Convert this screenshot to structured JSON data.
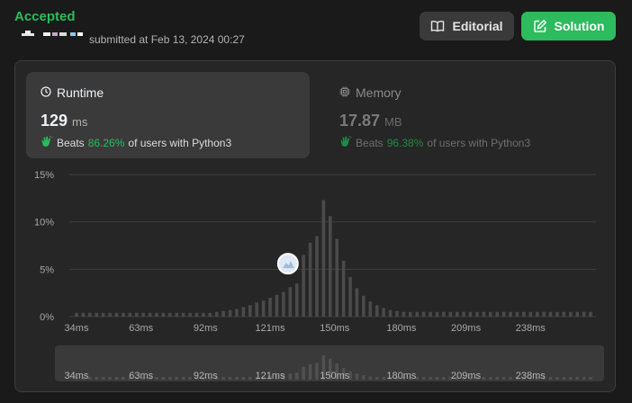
{
  "status": "Accepted",
  "submitted_text": "submitted at Feb 13, 2024 00:27",
  "buttons": {
    "editorial": "Editorial",
    "solution": "Solution"
  },
  "runtime": {
    "title": "Runtime",
    "value": "129",
    "unit": "ms",
    "beats_label": "Beats",
    "beats_pct": "86.26%",
    "beats_suffix": "of users with Python3"
  },
  "memory": {
    "title": "Memory",
    "value": "17.87",
    "unit": "MB",
    "beats_label": "Beats",
    "beats_pct": "96.38%",
    "beats_suffix": "of users with Python3"
  },
  "colors": {
    "accent": "#2cbb5d",
    "panel": "#262626",
    "bar": "#4a4a4a",
    "highlight": "#ffffff"
  },
  "chart_data": {
    "type": "bar",
    "title": "",
    "xlabel": "",
    "ylabel": "",
    "ylim": [
      0,
      15
    ],
    "y_ticks": [
      "15%",
      "10%",
      "5%",
      "0%"
    ],
    "x_tick_labels": [
      "34ms",
      "63ms",
      "92ms",
      "121ms",
      "150ms",
      "180ms",
      "209ms",
      "238ms"
    ],
    "x_tick_values": [
      34,
      63,
      92,
      121,
      150,
      180,
      209,
      238
    ],
    "x": [
      34,
      37,
      40,
      43,
      46,
      49,
      52,
      55,
      58,
      61,
      64,
      67,
      70,
      73,
      76,
      79,
      82,
      85,
      88,
      91,
      94,
      97,
      100,
      103,
      106,
      109,
      112,
      115,
      118,
      121,
      124,
      127,
      130,
      133,
      136,
      139,
      142,
      145,
      148,
      151,
      154,
      157,
      160,
      163,
      166,
      169,
      172,
      175,
      178,
      181,
      184,
      187,
      190,
      193,
      196,
      199,
      202,
      205,
      208,
      211,
      214,
      217,
      220,
      223,
      226,
      229,
      232,
      235,
      238,
      241,
      244,
      247,
      250,
      253,
      256,
      259,
      262,
      265
    ],
    "values": [
      0.4,
      0.4,
      0.4,
      0.4,
      0.4,
      0.4,
      0.4,
      0.4,
      0.4,
      0.4,
      0.4,
      0.4,
      0.4,
      0.4,
      0.4,
      0.4,
      0.4,
      0.4,
      0.4,
      0.4,
      0.4,
      0.5,
      0.6,
      0.7,
      0.8,
      1.0,
      1.2,
      1.5,
      1.7,
      2.0,
      2.3,
      2.6,
      3.1,
      3.5,
      6.5,
      7.8,
      8.5,
      12.3,
      10.6,
      8.2,
      5.9,
      4.2,
      3.0,
      2.2,
      1.6,
      1.2,
      0.9,
      0.7,
      0.6,
      0.5,
      0.5,
      0.5,
      0.5,
      0.5,
      0.5,
      0.5,
      0.5,
      0.5,
      0.5,
      0.5,
      0.5,
      0.5,
      0.5,
      0.5,
      0.5,
      0.5,
      0.5,
      0.5,
      0.5,
      0.5,
      0.5,
      0.5,
      0.5,
      0.5,
      0.5,
      0.5,
      0.5,
      0.5
    ],
    "highlight_x": 129,
    "highlight_value": 3.5,
    "grid": true
  }
}
